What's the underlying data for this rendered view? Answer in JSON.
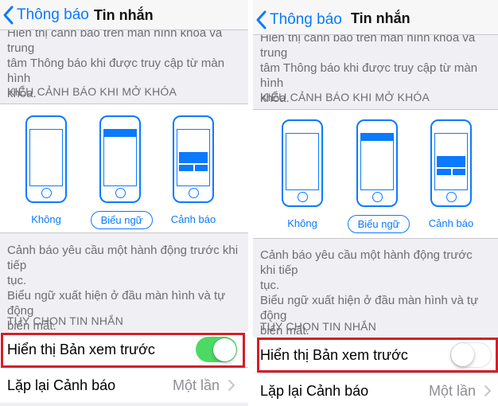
{
  "colors": {
    "ios_blue": "#0a7aff",
    "toggle_on": "#4cd964",
    "highlight_red": "#d51e2a"
  },
  "panels": [
    {
      "nav": {
        "back_label": "Thông báo",
        "title": "Tin nhắn",
        "back_icon": "chevron-left-icon"
      },
      "top_footer": {
        "line_1": "Hiển thị cảnh báo trên màn hình khóa và trung",
        "line_2": "tâm Thông báo khi được truy cập từ màn hình",
        "line_3": "khóa."
      },
      "alert_style_header": "KIỂU CẢNH BÁO KHI MỞ KHÓA",
      "alert_styles": [
        {
          "label": "Không",
          "selected": false
        },
        {
          "label": "Biểu ngữ",
          "selected": true
        },
        {
          "label": "Cảnh báo",
          "selected": false
        }
      ],
      "alert_footer": {
        "line_1": "Cảnh báo yêu cầu một hành động trước khi tiếp",
        "line_2": "tục.",
        "line_3": "Biểu ngữ xuất hiện ở đầu màn hình và tự động",
        "line_4": "biến mất."
      },
      "options_header": "TÙY CHỌN TIN NHẮN",
      "show_preview": {
        "label": "Hiển thị Bản xem trước",
        "on": true
      },
      "repeat_alerts": {
        "label": "Lặp lại Cảnh báo",
        "value": "Một lần"
      }
    },
    {
      "nav": {
        "back_label": "Thông báo",
        "title": "Tin nhắn",
        "back_icon": "chevron-left-icon"
      },
      "top_footer": {
        "line_1": "Hiển thị cảnh báo trên màn hình khóa và trung",
        "line_2": "tâm Thông báo khi được truy cập từ màn hình",
        "line_3": "khóa."
      },
      "alert_style_header": "KIỂU CẢNH BÁO KHI MỞ KHÓA",
      "alert_styles": [
        {
          "label": "Không",
          "selected": false
        },
        {
          "label": "Biểu ngữ",
          "selected": true
        },
        {
          "label": "Cảnh báo",
          "selected": false
        }
      ],
      "alert_footer": {
        "line_1": "Cảnh báo yêu cầu một hành động trước khi tiếp",
        "line_2": "tục.",
        "line_3": "Biểu ngữ xuất hiện ở đầu màn hình và tự động",
        "line_4": "biến mất."
      },
      "options_header": "TÙY CHỌN TIN NHẮN",
      "show_preview": {
        "label": "Hiển thị Bản xem trước",
        "on": false
      },
      "repeat_alerts": {
        "label": "Lặp lại Cảnh báo",
        "value": "Một lần"
      }
    }
  ]
}
